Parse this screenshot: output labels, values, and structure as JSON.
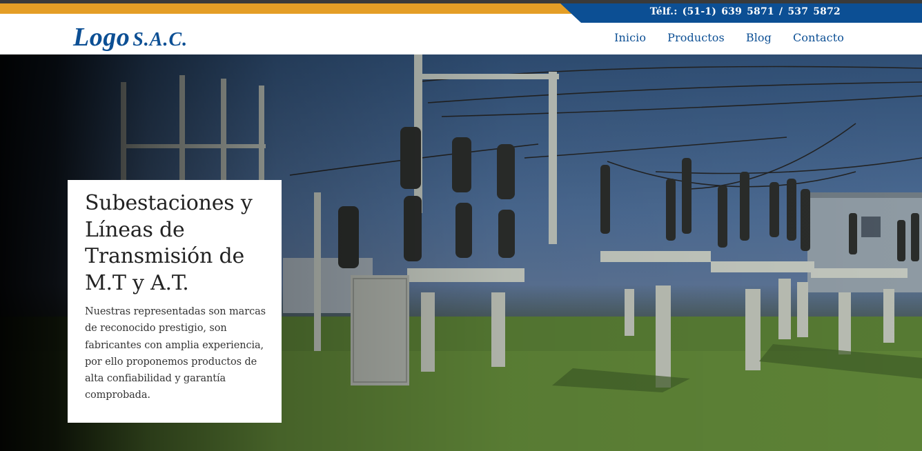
{
  "topbar": {
    "phone": "Télf.: (51-1) 639 5871 / 537 5872"
  },
  "header": {
    "logo_main": "Logo",
    "logo_suffix": "S.A.C.",
    "nav": [
      "Inicio",
      "Productos",
      "Blog",
      "Contacto"
    ]
  },
  "hero": {
    "title": "Subestaciones y Líneas de Transmisión de M.T y A.T.",
    "description": "Nuestras representadas son marcas de reconocido prestigio, son fabricantes con amplia experiencia, por ello proponemos productos de alta confiabilidad y garantía comprobada.",
    "background_image": "electrical-substation-photo"
  },
  "colors": {
    "brand_blue": "#0c4f94",
    "accent_orange": "#e49e26"
  }
}
